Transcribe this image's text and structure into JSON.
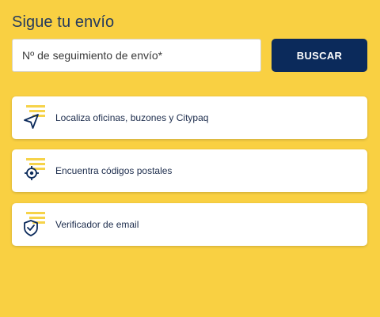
{
  "header": {
    "title": "Sigue tu envío"
  },
  "search": {
    "placeholder": "Nº de seguimiento de envío*",
    "button_label": "BUSCAR"
  },
  "links": [
    {
      "label": "Localiza oficinas, buzones y Citypaq",
      "icon": "location-arrow-icon"
    },
    {
      "label": "Encuentra códigos postales",
      "icon": "crosshair-icon"
    },
    {
      "label": "Verificador de email",
      "icon": "shield-check-icon"
    }
  ],
  "colors": {
    "background": "#f9d042",
    "button": "#0b2a5b",
    "title_text": "#243a5e",
    "icon_stroke": "#0b2a5b",
    "icon_accent": "#f6d34a"
  }
}
